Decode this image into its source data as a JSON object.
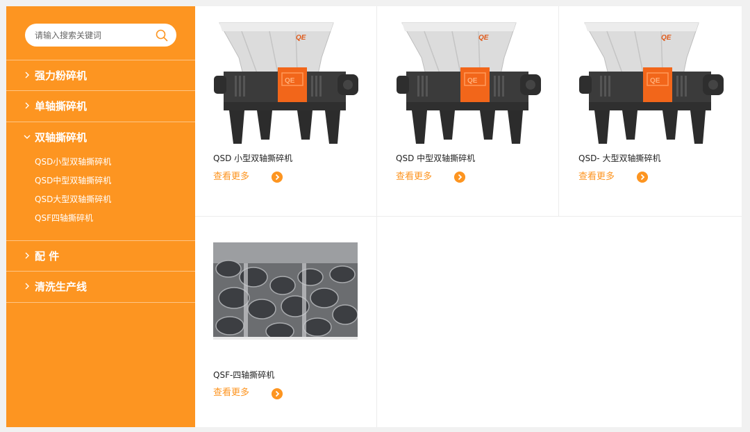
{
  "search": {
    "placeholder": "请输入搜索关键词"
  },
  "sidebar": {
    "items": [
      {
        "label": "强力粉碎机",
        "expanded": false
      },
      {
        "label": "单轴撕碎机",
        "expanded": false
      },
      {
        "label": "双轴撕碎机",
        "expanded": true,
        "children": [
          "QSD小型双轴撕碎机",
          "QSD中型双轴撕碎机",
          "QSD大型双轴撕碎机",
          "QSF四轴撕碎机"
        ]
      },
      {
        "label": "配 件",
        "expanded": false
      },
      {
        "label": "清洗生产线",
        "expanded": false
      }
    ]
  },
  "products": [
    {
      "title": "QSD 小型双轴撕碎机",
      "more": "查看更多",
      "image": "twin-shaft-shredder-machine"
    },
    {
      "title": "QSD 中型双轴撕碎机",
      "more": "查看更多",
      "image": "twin-shaft-shredder-machine"
    },
    {
      "title": "QSD- 大型双轴撕碎机",
      "more": "查看更多",
      "image": "twin-shaft-shredder-machine"
    },
    {
      "title": "QSF-四轴撕碎机",
      "more": "查看更多",
      "image": "four-shaft-blades-closeup"
    }
  ],
  "colors": {
    "accent": "#fd9521",
    "machine_body": "#3a3a3a",
    "hopper": "#d9d9d9",
    "panel": "#f26a1b"
  }
}
